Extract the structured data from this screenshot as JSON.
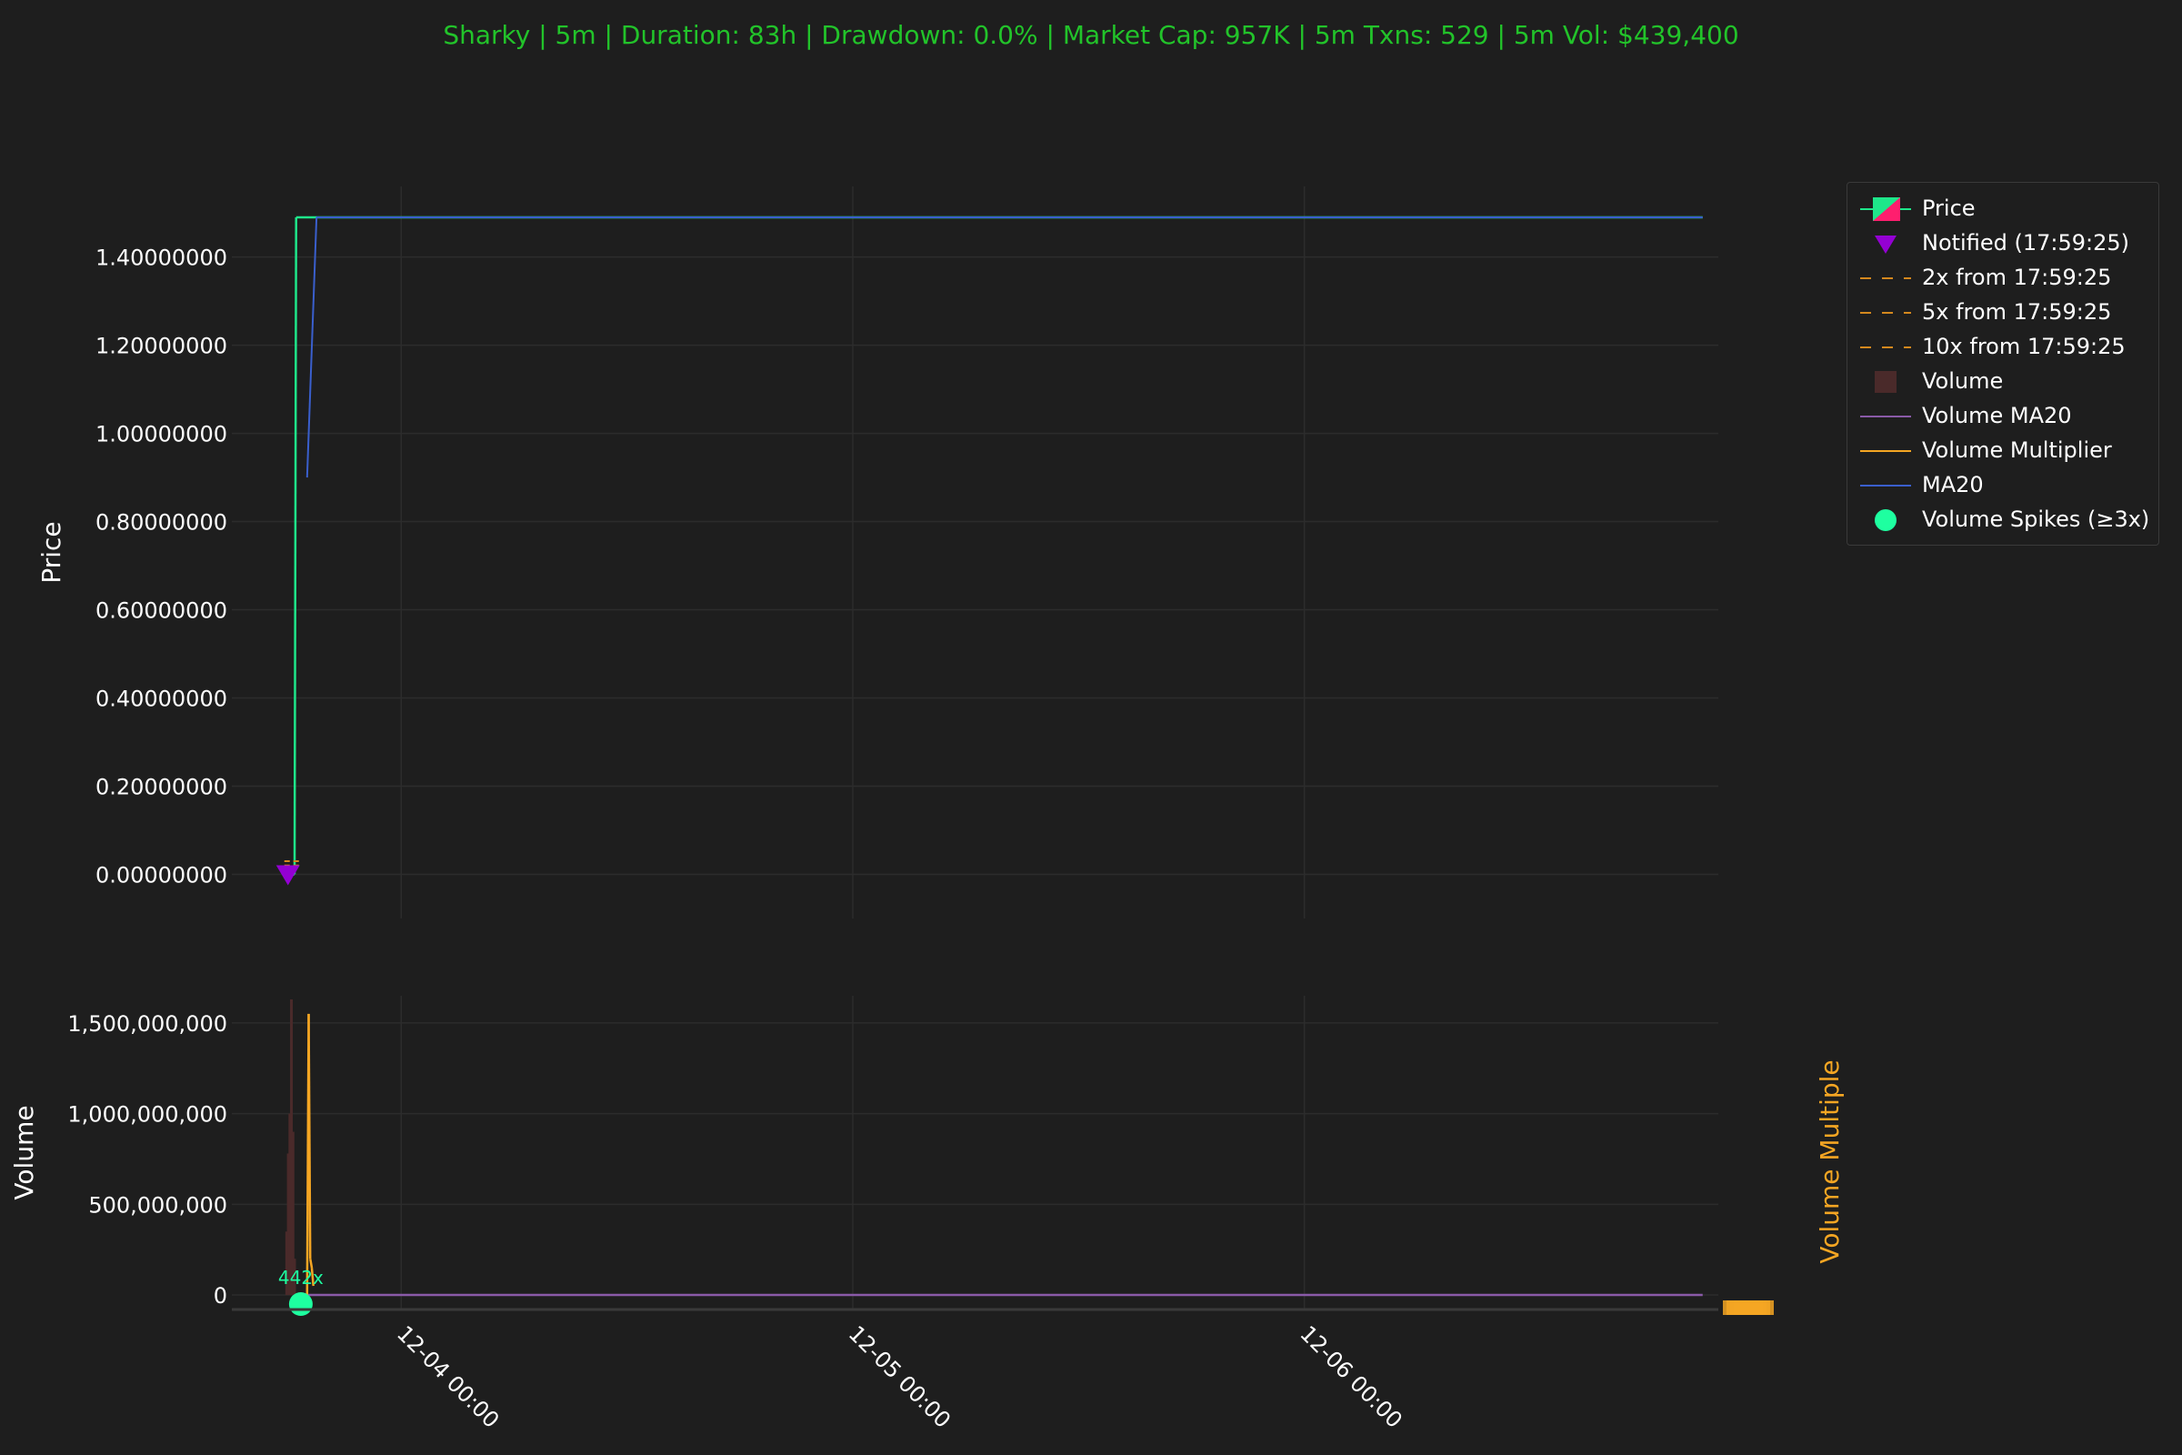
{
  "title": "Sharky | 5m | Duration: 83h | Drawdown: 0.0% | Market Cap: 957K | 5m Txns: 529 | 5m Vol: $439,400",
  "colors": {
    "background": "#1e1e1e",
    "title": "#22c32a",
    "price": "#1ee68a",
    "notified": "#9400d3",
    "multiplier_line": "#d4881e",
    "volume_bar": "#4a2a2a",
    "volume_ma": "#8a5aa8",
    "volume_multiplier": "#f5a623",
    "ma20": "#3a5fcd",
    "spike": "#1effa0"
  },
  "legend": [
    {
      "label": "Price",
      "icon": "candle-icon"
    },
    {
      "label": "Notified (17:59:25)",
      "icon": "triangle-down-icon"
    },
    {
      "label": "2x from 17:59:25",
      "icon": "dashed-line-icon"
    },
    {
      "label": "5x from 17:59:25",
      "icon": "dashed-line-icon"
    },
    {
      "label": "10x from 17:59:25",
      "icon": "dashed-line-icon"
    },
    {
      "label": "Volume",
      "icon": "bar-square-icon"
    },
    {
      "label": "Volume MA20",
      "icon": "line-icon"
    },
    {
      "label": "Volume Multiplier",
      "icon": "line-icon"
    },
    {
      "label": "MA20",
      "icon": "line-icon"
    },
    {
      "label": "Volume Spikes (≥3x)",
      "icon": "circle-icon"
    }
  ],
  "chart_data": [
    {
      "type": "line",
      "ylabel": "Price",
      "yticks": [
        "0.00000000",
        "0.20000000",
        "0.40000000",
        "0.60000000",
        "0.80000000",
        "1.00000000",
        "1.20000000",
        "1.40000000"
      ],
      "ylim": [
        -0.1,
        1.56
      ],
      "xlim": [
        "2024-12-03 15:00",
        "2024-12-06 22:00"
      ],
      "series": [
        {
          "name": "Price",
          "x": [
            "2024-12-03 17:59",
            "2024-12-03 18:20",
            "2024-12-03 18:25",
            "2024-12-06 21:10"
          ],
          "values": [
            0.0,
            0.0,
            1.49,
            1.49
          ]
        },
        {
          "name": "MA20",
          "x": [
            "2024-12-03 19:00",
            "2024-12-03 19:30",
            "2024-12-06 21:10"
          ],
          "values": [
            0.9,
            1.49,
            1.49
          ]
        }
      ],
      "notified": {
        "x": "2024-12-03 17:59",
        "value": 0.0
      }
    },
    {
      "type": "bar",
      "ylabel": "Volume",
      "y2label": "Volume Multiple",
      "xticks": [
        "12-04 00:00",
        "12-05 00:00",
        "12-06 00:00"
      ],
      "yticks": [
        "0",
        "500,000,000",
        "1,000,000,000",
        "1,500,000,000"
      ],
      "ylim": [
        -80000000,
        1650000000
      ],
      "series": [
        {
          "name": "Volume",
          "x": [
            "2024-12-03 17:55",
            "2024-12-03 18:00",
            "2024-12-03 18:05",
            "2024-12-03 18:10",
            "2024-12-03 18:15",
            "2024-12-03 18:20"
          ],
          "values": [
            350000000,
            780000000,
            1000000000,
            1630000000,
            900000000,
            200000000
          ]
        },
        {
          "name": "Volume MA20",
          "x": [
            "2024-12-03 19:00",
            "2024-12-06 21:10"
          ],
          "values": [
            0,
            0
          ]
        },
        {
          "name": "Volume Multiplier",
          "x": [
            "2024-12-03 19:00",
            "2024-12-03 19:05",
            "2024-12-03 19:10",
            "2024-12-03 19:15",
            "2024-12-03 19:20"
          ],
          "values": [
            0,
            1550000000,
            200000000,
            150000000,
            50000000
          ]
        }
      ],
      "spikes": [
        {
          "x": "2024-12-03 18:40",
          "label": "442x"
        }
      ]
    }
  ]
}
